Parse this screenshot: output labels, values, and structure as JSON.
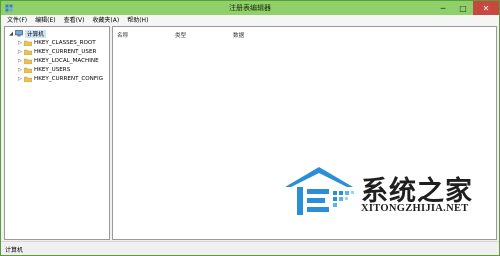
{
  "window": {
    "title": "注册表编辑器",
    "minimize": "─",
    "maximize": "□",
    "close": "✕",
    "icon": "registry-editor-icon"
  },
  "menu": [
    "文件(F)",
    "编辑(E)",
    "查看(V)",
    "收藏夹(A)",
    "帮助(H)"
  ],
  "tree": {
    "root": {
      "label": "计算机",
      "expander": "◢",
      "icon": "computer-icon"
    },
    "hives": [
      {
        "label": "HKEY_CLASSES_ROOT",
        "expander": "▷"
      },
      {
        "label": "HKEY_CURRENT_USER",
        "expander": "▷"
      },
      {
        "label": "HKEY_LOCAL_MACHINE",
        "expander": "▷"
      },
      {
        "label": "HKEY_USERS",
        "expander": "▷"
      },
      {
        "label": "HKEY_CURRENT_CONFIG",
        "expander": "▷"
      }
    ]
  },
  "list": {
    "columns": [
      "名称",
      "类型",
      "数据"
    ]
  },
  "watermark": {
    "name": "系统之家",
    "domain": "XITONGZHIJIA.NET",
    "brand_color": "#2a8fd6"
  },
  "status": {
    "path": "计算机"
  },
  "colors": {
    "titlebar": "#8fd06b",
    "close_button": "#c7483f",
    "selection": "#cce4f7",
    "folder": "#e8c157"
  }
}
